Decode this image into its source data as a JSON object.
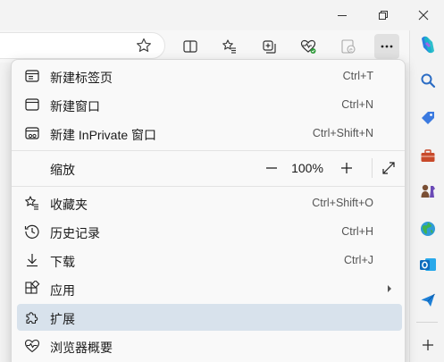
{
  "menu": {
    "items": [
      {
        "label": "新建标签页",
        "shortcut": "Ctrl+T"
      },
      {
        "label": "新建窗口",
        "shortcut": "Ctrl+N"
      },
      {
        "label": "新建 InPrivate 窗口",
        "shortcut": "Ctrl+Shift+N"
      },
      {
        "label": "收藏夹",
        "shortcut": "Ctrl+Shift+O"
      },
      {
        "label": "历史记录",
        "shortcut": "Ctrl+H"
      },
      {
        "label": "下载",
        "shortcut": "Ctrl+J"
      },
      {
        "label": "应用",
        "shortcut": ""
      },
      {
        "label": "扩展",
        "shortcut": ""
      },
      {
        "label": "浏览器概要",
        "shortcut": ""
      }
    ],
    "zoom": {
      "label": "缩放",
      "value": "100%",
      "minus": "−",
      "plus": "+"
    },
    "hovered_item": "扩展"
  },
  "sidebar": {
    "icons": [
      "copilot-icon",
      "search-icon",
      "tag-icon",
      "toolbox-icon",
      "chess-icon",
      "globe-icon",
      "outlook-icon",
      "send-icon",
      "add-icon"
    ]
  },
  "colors": {
    "hover": "#d8e2ec",
    "outlook": "#0f6cbd",
    "tools": "#c8492a"
  }
}
